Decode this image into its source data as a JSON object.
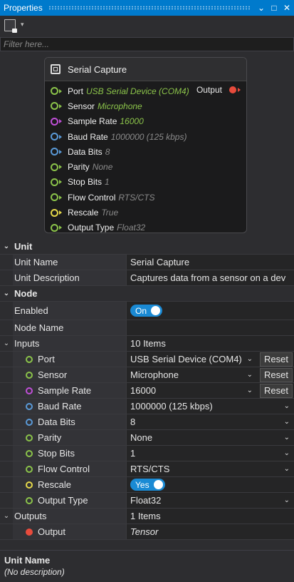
{
  "window": {
    "title": "Properties",
    "controls": [
      "⌄",
      "□",
      "✕"
    ]
  },
  "toolbar": {
    "dropdown_glyph": "▾"
  },
  "filter": {
    "placeholder": "Filter here..."
  },
  "node": {
    "title": "Serial Capture",
    "output": {
      "label": "Output",
      "color": "#e84b3c"
    },
    "ports": [
      {
        "name": "Port",
        "value": "USB Serial Device (COM4)",
        "value_color": "#8bc34a",
        "dot_color": "#8bc34a"
      },
      {
        "name": "Sensor",
        "value": "Microphone",
        "value_color": "#8bc34a",
        "dot_color": "#8bc34a"
      },
      {
        "name": "Sample Rate",
        "value": "16000",
        "value_color": "#8bc34a",
        "dot_color": "#c04fd8"
      },
      {
        "name": "Baud Rate",
        "value": "1000000 (125 kbps)",
        "value_color": "#8a8a8a",
        "dot_color": "#5a9ad8"
      },
      {
        "name": "Data Bits",
        "value": "8",
        "value_color": "#8a8a8a",
        "dot_color": "#5a9ad8"
      },
      {
        "name": "Parity",
        "value": "None",
        "value_color": "#8a8a8a",
        "dot_color": "#8bc34a"
      },
      {
        "name": "Stop Bits",
        "value": "1",
        "value_color": "#8a8a8a",
        "dot_color": "#8bc34a"
      },
      {
        "name": "Flow Control",
        "value": "RTS/CTS",
        "value_color": "#8a8a8a",
        "dot_color": "#8bc34a"
      },
      {
        "name": "Rescale",
        "value": "True",
        "value_color": "#8a8a8a",
        "dot_color": "#e6d94a"
      },
      {
        "name": "Output Type",
        "value": "Float32",
        "value_color": "#8a8a8a",
        "dot_color": "#8bc34a"
      }
    ]
  },
  "grid": {
    "unit": {
      "label": "Unit",
      "name_label": "Unit Name",
      "name_value": "Serial Capture",
      "desc_label": "Unit Description",
      "desc_value": "Captures data from a sensor on a dev"
    },
    "node_cat": {
      "label": "Node",
      "enabled_label": "Enabled",
      "enabled_value": "On",
      "nodename_label": "Node Name",
      "nodename_value": ""
    },
    "inputs": {
      "label": "Inputs",
      "count": "10 Items",
      "reset_label": "Reset",
      "rows": [
        {
          "name": "Port",
          "value": "USB Serial Device (COM4)",
          "dot_color": "#8bc34a"
        },
        {
          "name": "Sensor",
          "value": "Microphone",
          "dot_color": "#8bc34a"
        },
        {
          "name": "Sample Rate",
          "value": "16000",
          "dot_color": "#c04fd8"
        },
        {
          "name": "Baud Rate",
          "value": "1000000 (125 kbps)",
          "dot_color": "#5a9ad8"
        },
        {
          "name": "Data Bits",
          "value": "8",
          "dot_color": "#5a9ad8"
        },
        {
          "name": "Parity",
          "value": "None",
          "dot_color": "#8bc34a"
        },
        {
          "name": "Stop Bits",
          "value": "1",
          "dot_color": "#8bc34a"
        },
        {
          "name": "Flow Control",
          "value": "RTS/CTS",
          "dot_color": "#8bc34a"
        },
        {
          "name": "Rescale",
          "value": "Yes",
          "dot_color": "#e6d94a"
        },
        {
          "name": "Output Type",
          "value": "Float32",
          "dot_color": "#8bc34a"
        }
      ]
    },
    "outputs": {
      "label": "Outputs",
      "count": "1 Items",
      "rows": [
        {
          "name": "Output",
          "value": "Tensor",
          "dot_color": "#e84b3c"
        }
      ]
    }
  },
  "description": {
    "title": "Unit Name",
    "text": "(No description)"
  }
}
